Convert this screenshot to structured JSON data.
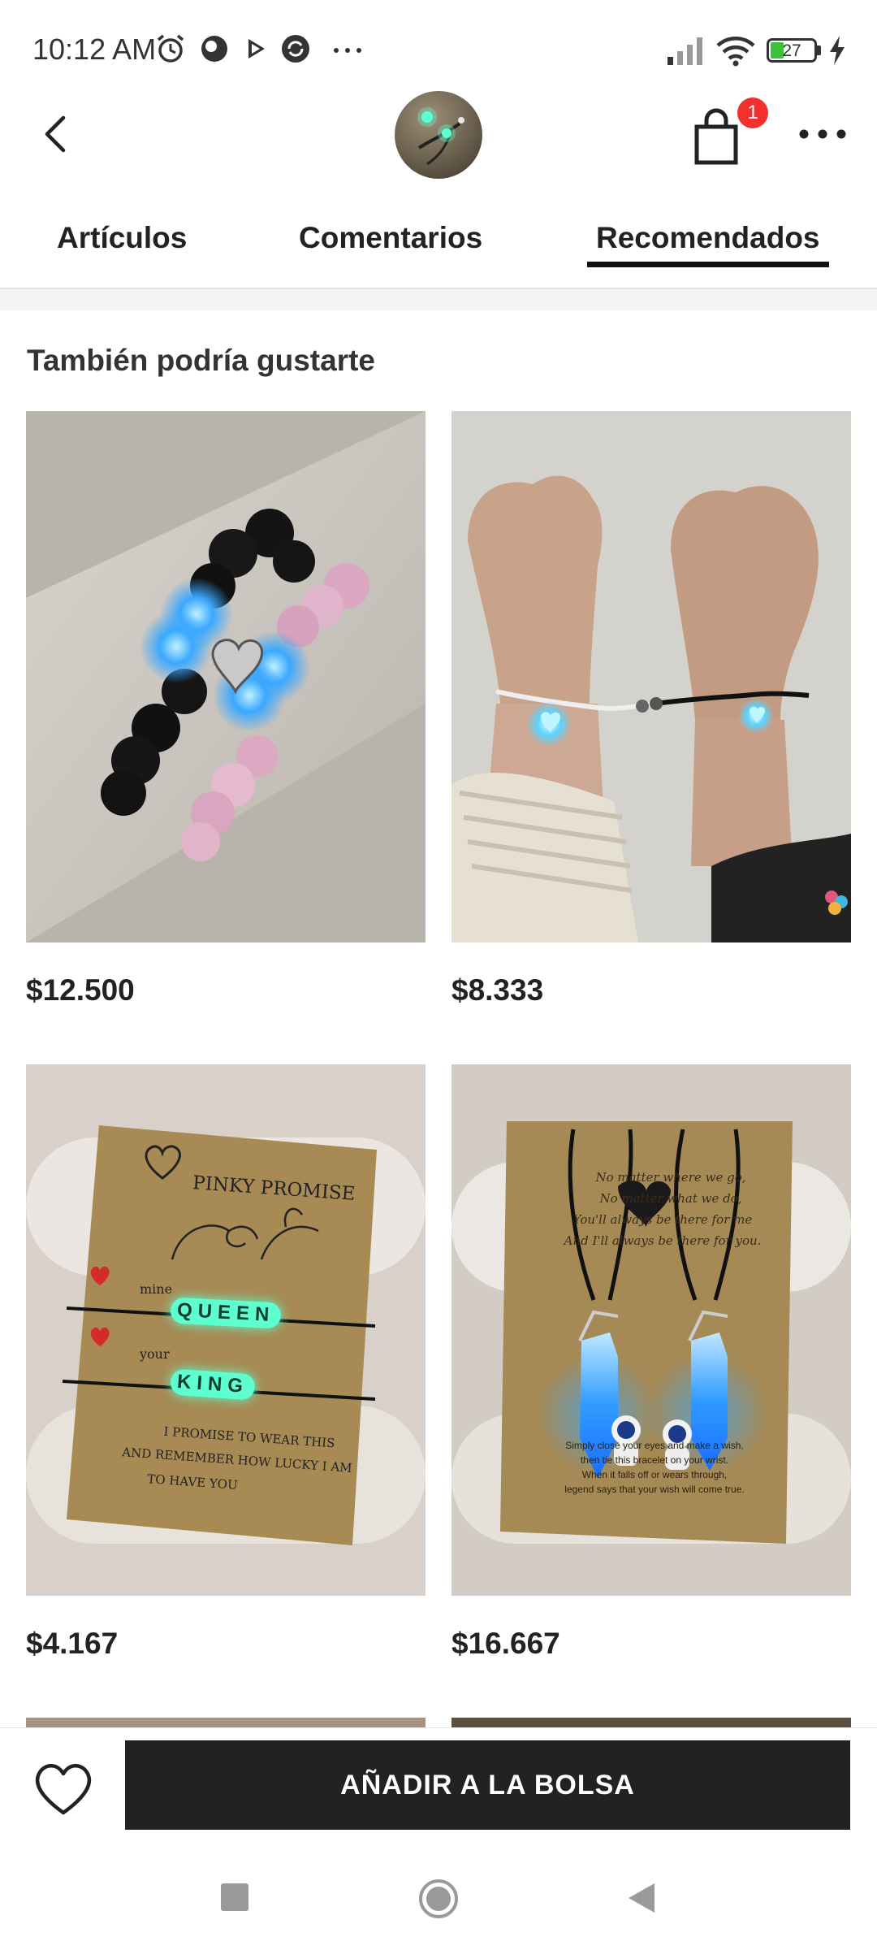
{
  "status_bar": {
    "time": "10:12 AM",
    "battery": "27",
    "icons": [
      "alarm-icon",
      "app-icon",
      "play-icon",
      "sync-icon",
      "more-dots-icon",
      "signal-icon",
      "wifi-icon",
      "battery-icon",
      "charging-icon"
    ]
  },
  "header": {
    "cart_count": "1"
  },
  "tabs": [
    {
      "label": "Artículos",
      "active": false
    },
    {
      "label": "Comentarios",
      "active": false
    },
    {
      "label": "Recomendados",
      "active": true
    }
  ],
  "section": {
    "title": "También podría gustarte"
  },
  "products": [
    {
      "price": "$12.500",
      "image": "glowing bead bracelets with magnetic hearts"
    },
    {
      "price": "$8.333",
      "image": "two wrists with glowing heart bracelets"
    },
    {
      "price": "$4.167",
      "image": "pinky promise card with queen and king bracelets",
      "card_text": {
        "title": "PINKY PROMISE",
        "mine": "mine",
        "queen": "QUEEN",
        "your": "your",
        "king": "KING",
        "line1": "I PROMISE TO WEAR THIS",
        "line2": "AND REMEMBER HOW LUCKY I AM",
        "line3": "TO HAVE YOU"
      }
    },
    {
      "price": "$16.667",
      "image": "astronaut crystal necklaces on card",
      "card_text": {
        "line1": "No matter where we go,",
        "line2": "No matter what we do,",
        "line3": "You'll always be there for me",
        "line4": "And I'll always be there for you.",
        "line5": "Simply close your eyes and make a wish,",
        "line6": "then tie this bracelet on your wrist.",
        "line7": "When it falls off or wears through,",
        "line8": "legend says that your wish will come true."
      }
    }
  ],
  "bottom_bar": {
    "add_to_bag": "AÑADIR A LA BOLSA"
  },
  "colors": {
    "accent": "#222222",
    "badge": "#f2302e",
    "glow_blue": "#3aa8ff",
    "glow_green": "#5dffd0"
  }
}
